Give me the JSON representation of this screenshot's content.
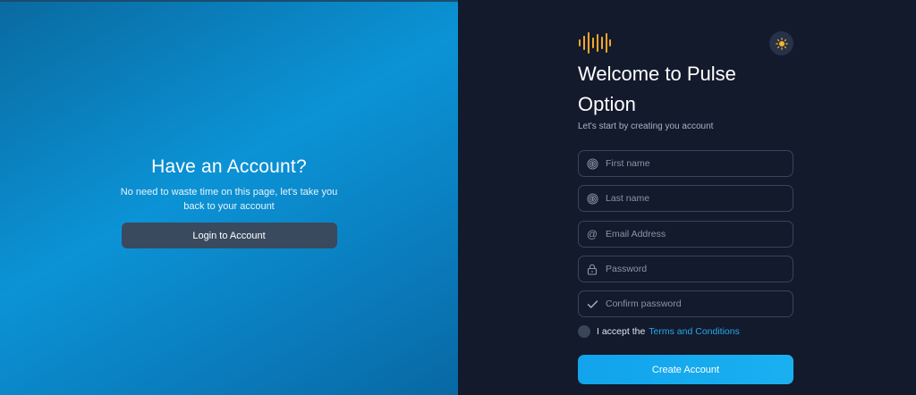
{
  "left": {
    "title": "Have an Account?",
    "subtitle": "No need to waste time on this page, let's take you back to your account",
    "login_label": "Login to Account"
  },
  "right": {
    "logo_icon": "sound-wave-icon",
    "theme_icon": "sun-icon",
    "title": "Welcome to Pulse Option",
    "subtitle": "Let's start by creating you account",
    "fields": [
      {
        "name": "first-name-input",
        "icon": "fingerprint-icon",
        "placeholder": "First name",
        "value": ""
      },
      {
        "name": "last-name-input",
        "icon": "fingerprint-icon",
        "placeholder": "Last name",
        "value": ""
      },
      {
        "name": "email-input",
        "icon": "at-icon",
        "placeholder": "Email Address",
        "value": ""
      },
      {
        "name": "password-input",
        "icon": "lock-icon",
        "placeholder": "Password",
        "value": ""
      },
      {
        "name": "confirm-password-input",
        "icon": "check-icon",
        "placeholder": "Confirm password",
        "value": ""
      }
    ],
    "terms_prefix": "I accept the",
    "terms_link": "Terms and Conditions",
    "create_label": "Create Account"
  },
  "colors": {
    "accent": "#12a3ec",
    "logo": "#f4a62a",
    "panel_dark": "#121a2c"
  }
}
